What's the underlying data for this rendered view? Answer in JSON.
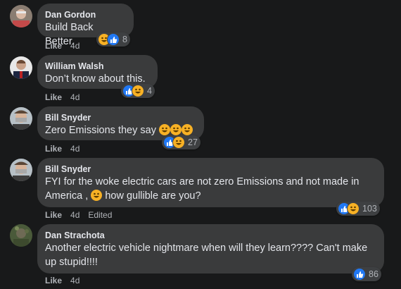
{
  "comments": [
    {
      "author": "Dan Gordon",
      "text": "Build Back Better.",
      "reaction_count": "8",
      "reactions": [
        "haha",
        "like"
      ],
      "like_label": "Like",
      "time": "4d"
    },
    {
      "author": "William Walsh",
      "text": "Don’t know about this.",
      "reaction_count": "4",
      "reactions": [
        "like",
        "haha"
      ],
      "like_label": "Like",
      "time": "4d"
    },
    {
      "author": "Bill Snyder",
      "text": "Zero Emissions they say",
      "inline_emoji": [
        "haha",
        "haha",
        "haha"
      ],
      "reaction_count": "27",
      "reactions": [
        "like",
        "haha"
      ],
      "like_label": "Like",
      "time": "4d"
    },
    {
      "author": "Bill Snyder",
      "text_line1": "FYI for the woke electric cars are not zero Emissions and not made in",
      "text_line2_a": "America ,",
      "text_line2_b": "how gullible are you?",
      "inline_emoji": [
        "haha"
      ],
      "reaction_count": "103",
      "reactions": [
        "like",
        "haha"
      ],
      "like_label": "Like",
      "time": "4d",
      "edited": "Edited"
    },
    {
      "author": "Dan Strachota",
      "text_line1": "Another electric vehicle nightmare when will they learn???? Can't make",
      "text_line2": "up stupid!!!!",
      "reaction_count": "86",
      "reactions": [
        "like"
      ],
      "like_label": "Like",
      "time": "4d"
    }
  ],
  "colors": {
    "background": "#18191a",
    "bubble": "#3a3b3c",
    "text": "#e4e6eb",
    "secondary_text": "#b0b3b8",
    "like_blue": "#2078f4",
    "haha_yellow": "#f7b125"
  }
}
